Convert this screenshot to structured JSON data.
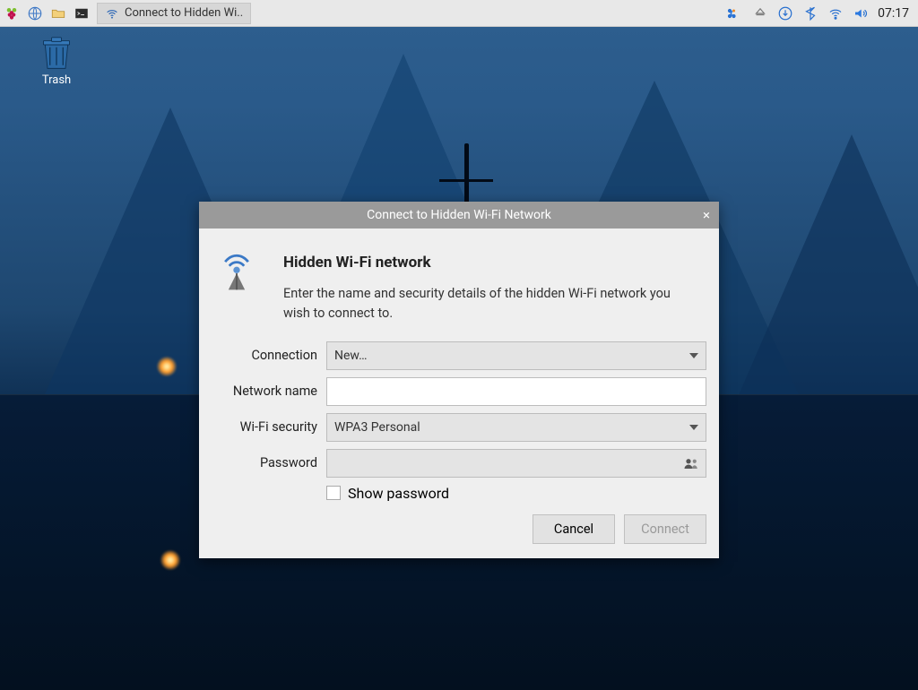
{
  "desktop": {
    "trash_label": "Trash"
  },
  "taskbar": {
    "window_label": "Connect to Hidden Wi..",
    "clock": "07:17"
  },
  "dialog": {
    "title": "Connect to Hidden Wi-Fi Network",
    "heading": "Hidden Wi-Fi network",
    "description": "Enter the name and security details of the hidden Wi-Fi network you wish to connect to.",
    "labels": {
      "connection": "Connection",
      "network_name": "Network name",
      "security": "Wi-Fi security",
      "password": "Password",
      "show_password": "Show password"
    },
    "values": {
      "connection": "New…",
      "network_name": "",
      "security": "WPA3 Personal",
      "password": ""
    },
    "buttons": {
      "cancel": "Cancel",
      "connect": "Connect"
    }
  }
}
